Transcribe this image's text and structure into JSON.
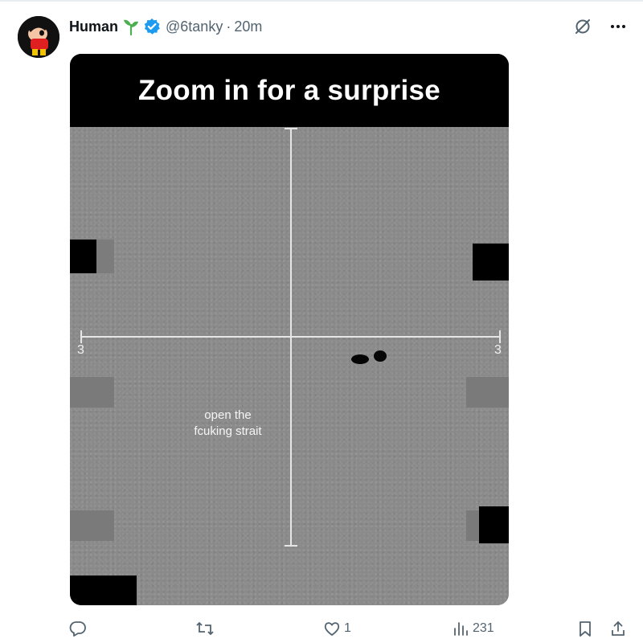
{
  "tweet": {
    "display_name": "Human",
    "handle": "@6tanky",
    "separator": "·",
    "time": "20m"
  },
  "icons": {
    "sprout": "sprout-icon",
    "verified": "verified-badge-icon",
    "grok": "grok-icon",
    "more": "more-options-icon"
  },
  "media": {
    "title": "Zoom in for a surprise",
    "caption_line1": "open the",
    "caption_line2": "fcuking strait",
    "left_tick": "3",
    "right_tick": "3"
  },
  "actions": {
    "reply_count": "",
    "retweet_count": "",
    "like_count": "1",
    "views_count": "231"
  },
  "colors": {
    "verified": "#1d9bf0",
    "sprout": "#4caf50",
    "muted": "#536471",
    "media_bg": "#8a8a8a"
  }
}
